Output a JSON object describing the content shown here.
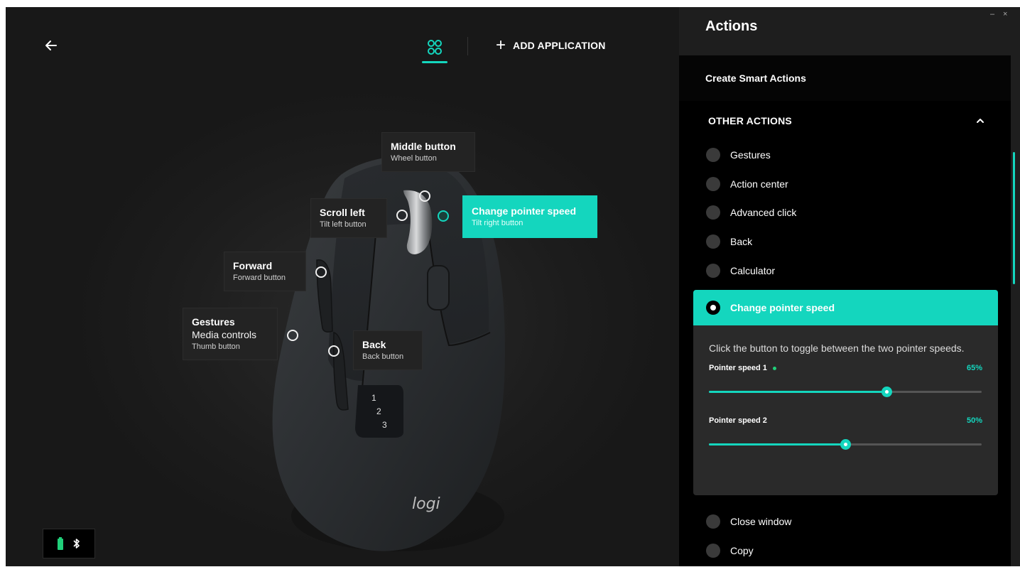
{
  "header": {
    "add_application": "ADD APPLICATION"
  },
  "callouts": {
    "middle": {
      "title": "Middle button",
      "sub": "Wheel button"
    },
    "scroll_left": {
      "title": "Scroll left",
      "sub": "Tilt left button"
    },
    "change_speed": {
      "title": "Change pointer speed",
      "sub": "Tilt right button"
    },
    "forward": {
      "title": "Forward",
      "sub": "Forward button"
    },
    "gestures": {
      "title": "Gestures",
      "title2": "Media controls",
      "sub": "Thumb button"
    },
    "back": {
      "title": "Back",
      "sub": "Back button"
    }
  },
  "mouse": {
    "mode_numbers": [
      "1",
      "2",
      "3"
    ],
    "logo": "logi"
  },
  "window": {
    "minimize": "–",
    "close": "×"
  },
  "panel": {
    "title": "Actions",
    "smart_actions": "Create Smart Actions",
    "other_actions": "OTHER ACTIONS",
    "items_before": [
      "Gestures",
      "Action center",
      "Advanced click",
      "Back",
      "Calculator"
    ],
    "selected": {
      "label": "Change pointer speed",
      "description": "Click the button to toggle between the two pointer speeds.",
      "speed1_label": "Pointer speed 1",
      "speed1_value": "65%",
      "speed1_fraction": 0.65,
      "speed2_label": "Pointer speed 2",
      "speed2_value": "50%",
      "speed2_fraction": 0.5
    },
    "items_after": [
      "Close window",
      "Copy"
    ]
  },
  "colors": {
    "accent": "#14d6be",
    "battery": "#20d07a"
  }
}
